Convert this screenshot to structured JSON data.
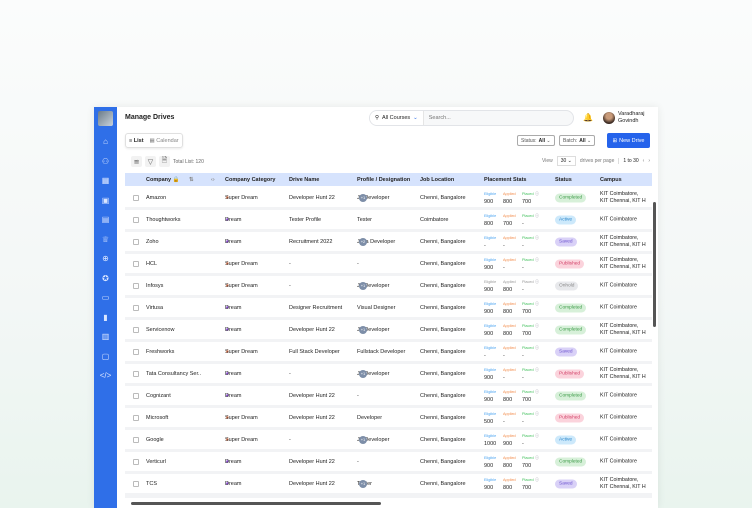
{
  "sidebar": {
    "icons": [
      "home-icon",
      "users-icon",
      "grid-icon",
      "clipboard-icon",
      "book-icon",
      "trophy-icon",
      "plus-circle-icon",
      "award-icon",
      "briefcase-icon",
      "chart-icon",
      "id-card-icon",
      "chat-icon",
      "code-icon"
    ]
  },
  "header": {
    "title": "Manage Drives",
    "course_filter": "All Courses",
    "search_placeholder": "Search...",
    "user_first": "Varadharaj",
    "user_last": "Govindh"
  },
  "views": {
    "list": "List",
    "calendar": "Calendar"
  },
  "filters": {
    "status_label": "Status:",
    "status_value": "All",
    "batch_label": "Batch:",
    "batch_value": "All",
    "new_drive": "New Drive"
  },
  "toolbar": {
    "total": "Total List: 120"
  },
  "pager": {
    "view": "View",
    "per_page": "30",
    "suffix": "drives per page",
    "range": "1 to 30"
  },
  "columns": [
    "Company",
    "Company Category",
    "Drive Name",
    "Profile / Designation",
    "Job Location",
    "Placement Stats",
    "Status",
    "Campus"
  ],
  "stat_labels": [
    "Eligible",
    "Applied",
    "Placed"
  ],
  "colors": {
    "accent": "#2f6fe8",
    "super_dream": "#f47a4a",
    "dream": "#7b3fc4"
  },
  "rows": [
    {
      "company": "Amazon",
      "category": "Super Dream",
      "drive": "Developer Hunt 22",
      "profile": "Jr. Developer",
      "more": "+1",
      "location": "Chenni, Bangalore",
      "eligible": "900",
      "applied": "800",
      "placed": "700",
      "status": "Completed",
      "campus": [
        "KIT Coimbatore,",
        "KIT Chennai, KIT H"
      ]
    },
    {
      "company": "Thoughtworks",
      "category": "Dream",
      "drive": "Tester Profile",
      "profile": "Tester",
      "more": "",
      "location": "Coimbatore",
      "eligible": "800",
      "applied": "700",
      "placed": "-",
      "status": "Active",
      "campus": [
        "KIT Coimbatore"
      ]
    },
    {
      "company": "Zoho",
      "category": "Dream",
      "drive": "Recruitment 2022",
      "profile": "Java Developer",
      "more": "+2",
      "location": "Chenni, Bangalore",
      "eligible": "-",
      "applied": "-",
      "placed": "-",
      "status": "Saved",
      "campus": [
        "KIT Coimbatore,",
        "KIT Chennai, KIT H"
      ]
    },
    {
      "company": "HCL",
      "category": "Super Dream",
      "drive": "-",
      "profile": "-",
      "more": "",
      "location": "Chenni, Bangalore",
      "eligible": "900",
      "applied": "-",
      "placed": "-",
      "status": "Published",
      "campus": [
        "KIT Coimbatore,",
        "KIT Chennai, KIT H"
      ]
    },
    {
      "company": "Infosys",
      "category": "Super Dream",
      "drive": "-",
      "profile": "Jr. Developer",
      "more": "+1",
      "location": "Chenni, Bangalore",
      "eligible": "900",
      "applied": "800",
      "placed": "-",
      "status": "Onhold",
      "campus": [
        "KIT Coimbatore"
      ]
    },
    {
      "company": "Virtusa",
      "category": "Dream",
      "drive": "Designer Recruitment",
      "profile": "Visual Designer",
      "more": "",
      "location": "Chenni, Bangalore",
      "eligible": "900",
      "applied": "800",
      "placed": "700",
      "status": "Completed",
      "campus": [
        "KIT Coimbatore"
      ]
    },
    {
      "company": "Servicenow",
      "category": "Dream",
      "drive": "Developer Hunt 22",
      "profile": "Jr. Developer",
      "more": "+1",
      "location": "Chenni, Bangalore",
      "eligible": "900",
      "applied": "800",
      "placed": "700",
      "status": "Completed",
      "campus": [
        "KIT Coimbatore,",
        "KIT Chennai, KIT H"
      ]
    },
    {
      "company": "Freshworks",
      "category": "Super Dream",
      "drive": "Full Stack Developer",
      "profile": "Fullstack Developer",
      "more": "",
      "location": "Chenni, Bangalore",
      "eligible": "-",
      "applied": "-",
      "placed": "-",
      "status": "Saved",
      "campus": [
        "KIT Coimbatore"
      ]
    },
    {
      "company": "Tata Consultancy Ser..",
      "category": "Dream",
      "drive": "-",
      "profile": "Jr. Developer",
      "more": "+1",
      "location": "Chenni, Bangalore",
      "eligible": "900",
      "applied": "-",
      "placed": "-",
      "status": "Published",
      "campus": [
        "KIT Coimbatore,",
        "KIT Chennai, KIT H"
      ]
    },
    {
      "company": "Cognizant",
      "category": "Dream",
      "drive": "Developer Hunt 22",
      "profile": "-",
      "more": "",
      "location": "Chenni, Bangalore",
      "eligible": "900",
      "applied": "800",
      "placed": "700",
      "status": "Completed",
      "campus": [
        "KIT Coimbatore"
      ]
    },
    {
      "company": "Microsoft",
      "category": "Super Dream",
      "drive": "Developer Hunt 22",
      "profile": "Developer",
      "more": "",
      "location": "Chenni, Bangalore",
      "eligible": "500",
      "applied": "-",
      "placed": "-",
      "status": "Published",
      "campus": [
        "KIT Coimbatore"
      ]
    },
    {
      "company": "Google",
      "category": "Super Dream",
      "drive": "-",
      "profile": "Jr. Developer",
      "more": "+1",
      "location": "Chenni, Bangalore",
      "eligible": "1000",
      "applied": "900",
      "placed": "-",
      "status": "Active",
      "campus": [
        "KIT Coimbatore"
      ]
    },
    {
      "company": "Verticurl",
      "category": "Dream",
      "drive": "Developer Hunt 22",
      "profile": "-",
      "more": "",
      "location": "Chenni, Bangalore",
      "eligible": "900",
      "applied": "800",
      "placed": "700",
      "status": "Completed",
      "campus": [
        "KIT Coimbatore"
      ]
    },
    {
      "company": "TCS",
      "category": "Dream",
      "drive": "Developer Hunt 22",
      "profile": "Tester",
      "more": "+1",
      "location": "Chenni, Bangalore",
      "eligible": "900",
      "applied": "800",
      "placed": "700",
      "status": "Saved",
      "campus": [
        "KIT Coimbatore,",
        "KIT Chennai, KIT H"
      ]
    }
  ]
}
